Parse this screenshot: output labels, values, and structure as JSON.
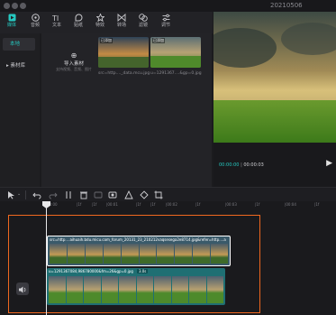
{
  "window": {
    "title": "20210506"
  },
  "topbar": {
    "items": [
      {
        "label": "媒体",
        "icon": "media-icon",
        "active": true
      },
      {
        "label": "音频",
        "icon": "audio-icon"
      },
      {
        "label": "文本",
        "icon": "text-icon"
      },
      {
        "label": "贴纸",
        "icon": "sticker-icon"
      },
      {
        "label": "特效",
        "icon": "effects-icon"
      },
      {
        "label": "转场",
        "icon": "transition-icon"
      },
      {
        "label": "滤镜",
        "icon": "filter-icon"
      },
      {
        "label": "调节",
        "icon": "adjust-icon"
      }
    ]
  },
  "sidebar": {
    "items": [
      {
        "label": "本地",
        "active": true
      },
      {
        "label": "素材库",
        "prefix": "▸"
      }
    ]
  },
  "media": {
    "import_label": "导入素材",
    "import_sub": "支持视频、音频、图片",
    "thumbs": [
      {
        "badge": "已添加",
        "caption": "src=http...._data.mcu.jpg"
      },
      {
        "badge": "已添加",
        "caption": "u=1291367....&gp=0.jpg"
      }
    ]
  },
  "preview": {
    "time_current": "00:00:00",
    "time_total": "00:00:03"
  },
  "timeline": {
    "ticks": [
      "00:00",
      "|1f",
      "|1f",
      "|00:01",
      "|1f",
      "|1f",
      "|00:02",
      "|1f",
      "|00:03",
      "|1f",
      "|00:04",
      "|1f"
    ],
    "clip1_label": "src=http....aihuaih.bdu.micu.com_forum_20131_23_210212vaqsesega2e8714.jpg&refer=http....a",
    "clip2_label": "u=1291367084,986780000&fm=26&gp=0.jpg",
    "clip2_speed": "3.0s"
  },
  "colors": {
    "accent": "#25c9c1",
    "highlight": "#f0681f"
  }
}
